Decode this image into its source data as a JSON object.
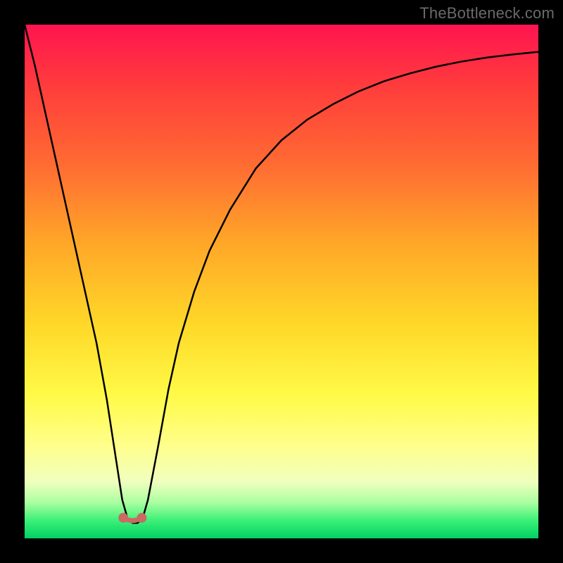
{
  "attribution": "TheBottleneck.com",
  "colors": {
    "frame": "#000000",
    "curve": "#000000",
    "marker": "#c96a63",
    "gradient_top": "#ff1450",
    "gradient_bottom": "#00d264"
  },
  "chart_data": {
    "type": "line",
    "title": "",
    "xlabel": "",
    "ylabel": "",
    "xlim": [
      0,
      100
    ],
    "ylim": [
      0,
      100
    ],
    "grid": false,
    "legend": false,
    "series": [
      {
        "name": "bottleneck-curve",
        "x": [
          0,
          2,
          4,
          6,
          8,
          10,
          12,
          14,
          16,
          18,
          19,
          20,
          21,
          22,
          23,
          24,
          26,
          28,
          30,
          33,
          36,
          40,
          45,
          50,
          55,
          60,
          65,
          70,
          75,
          80,
          85,
          90,
          95,
          100
        ],
        "values": [
          100,
          92,
          83,
          74,
          65,
          56,
          47,
          38,
          27,
          14,
          7.5,
          4.0,
          3.0,
          3.0,
          4.0,
          7.5,
          18,
          29,
          38,
          48,
          56,
          64,
          72,
          77.5,
          81.5,
          84.5,
          87,
          89,
          90.5,
          91.8,
          92.8,
          93.6,
          94.2,
          94.7
        ]
      }
    ],
    "markers": [
      {
        "name": "valley-left",
        "x": 19.2,
        "y": 4.0
      },
      {
        "name": "valley-right",
        "x": 22.8,
        "y": 4.0
      }
    ],
    "annotations": []
  }
}
